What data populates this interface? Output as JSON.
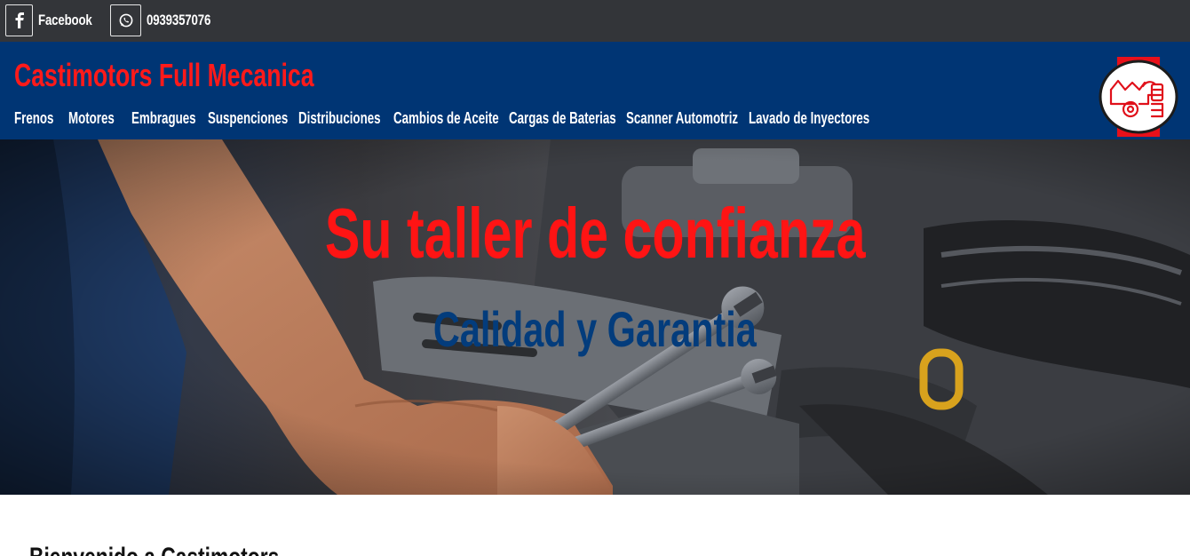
{
  "topbar": {
    "facebook": {
      "label": "Facebook",
      "icon": "facebook-icon"
    },
    "whatsapp": {
      "label": "0939357076",
      "icon": "whatsapp-icon"
    }
  },
  "header": {
    "brand": "Castimotors Full Mecanica",
    "nav": [
      "Frenos",
      "Motores",
      "Embragues",
      "Suspenciones",
      "Distribuciones",
      "Cambios de Aceite",
      "Cargas de Baterias",
      "Scanner Automotriz",
      "Lavado de Inyectores"
    ],
    "logo": "castimotors-logo"
  },
  "hero": {
    "title": "Su taller de confianza",
    "subtitle": "Calidad y Garantia"
  },
  "welcome": {
    "heading": "Bienvenido a Castimotors"
  },
  "colors": {
    "topbar_bg": "#333539",
    "header_bg": "#003574",
    "brand_red": "#ff1a1a",
    "subtitle_blue": "#033c7c"
  }
}
